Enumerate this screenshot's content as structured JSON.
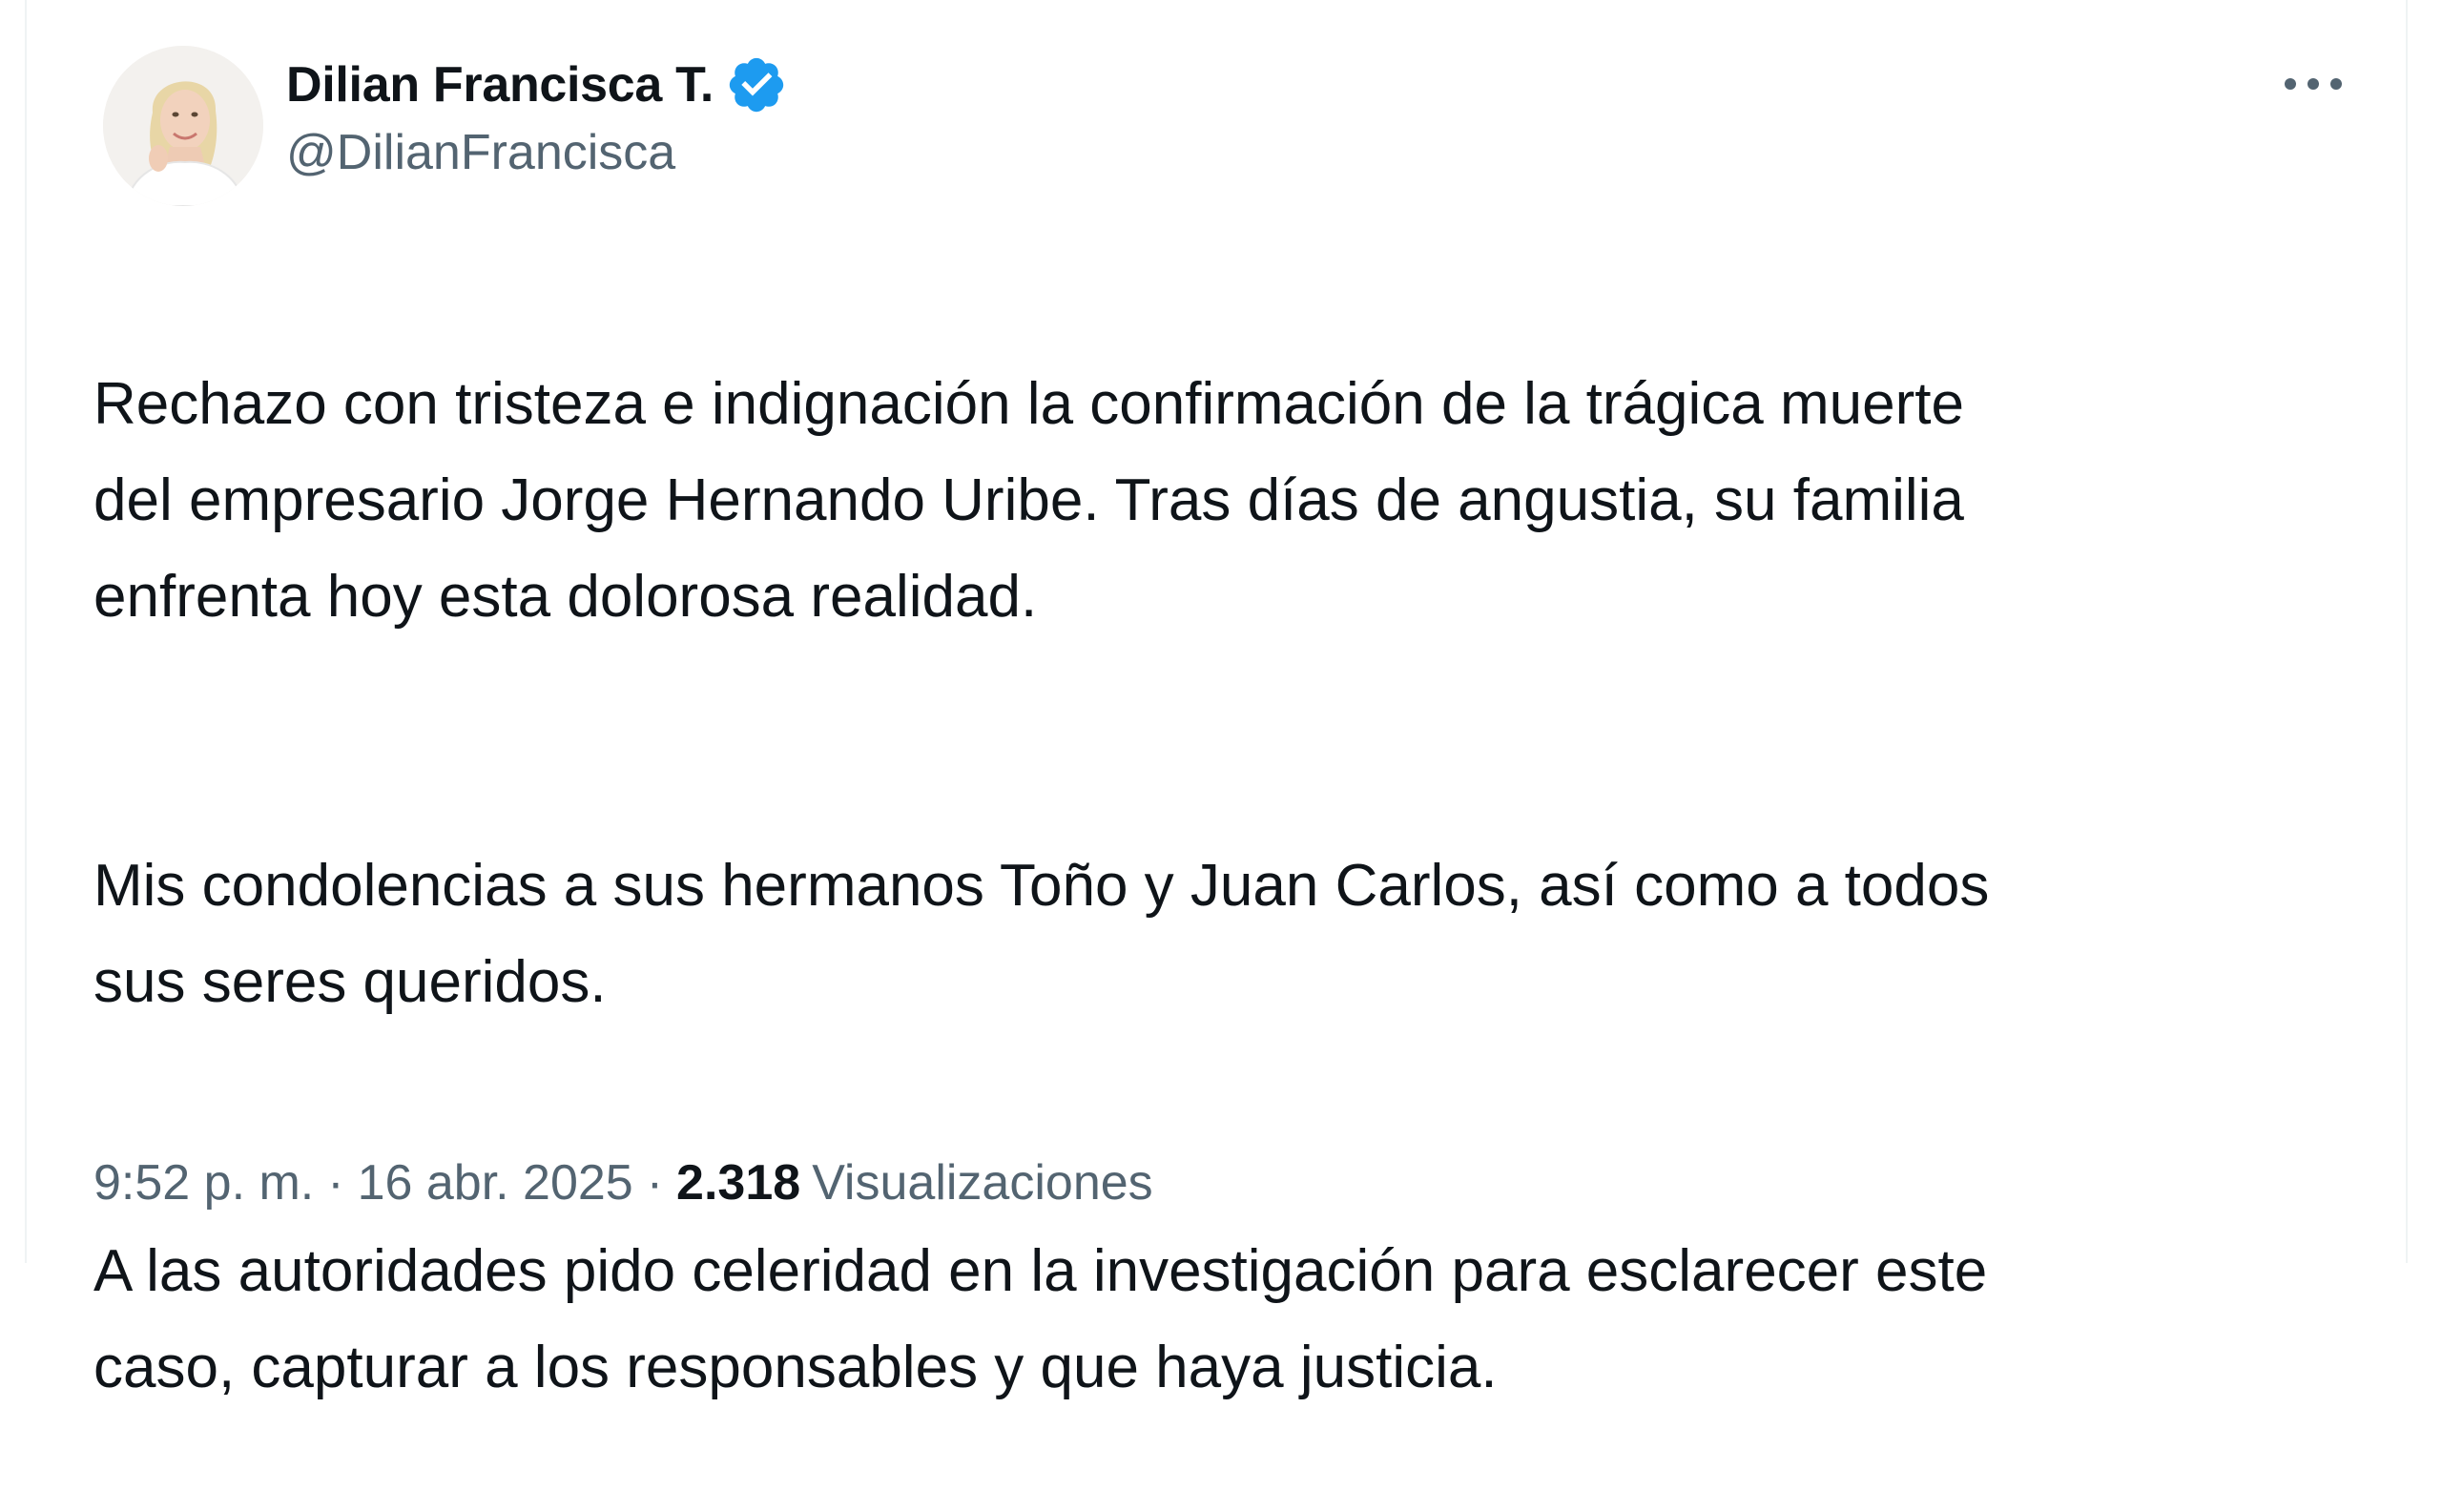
{
  "author": {
    "display_name": "Dilian Francisca T.",
    "handle": "@DilianFrancisca",
    "verified": true,
    "avatar": "profile-photo-woman-blonde"
  },
  "tweet": {
    "paragraphs": [
      "Rechazo con tristeza e indignación la confirmación de la trágica muerte\ndel empresario Jorge Hernando Uribe. Tras días de angustia, su familia\nenfrenta hoy esta dolorosa realidad.",
      "Mis condolencias a sus hermanos Toño y Juan Carlos, así como a todos\nsus seres queridos.",
      "A las autoridades pido celeridad en la investigación para esclarecer este\ncaso, capturar a los responsables y que haya justicia."
    ]
  },
  "meta": {
    "time": "9:52 p. m.",
    "separator": "·",
    "date": "16 abr. 2025",
    "views_count": "2.318",
    "views_label": "Visualizaciones"
  },
  "icons": {
    "more": "more-horizontal-icon",
    "verified": "verified-badge-icon"
  },
  "colors": {
    "text_primary": "#0f1419",
    "text_secondary": "#536471",
    "verified_blue": "#1d9bf0",
    "border": "#eff3f4"
  }
}
